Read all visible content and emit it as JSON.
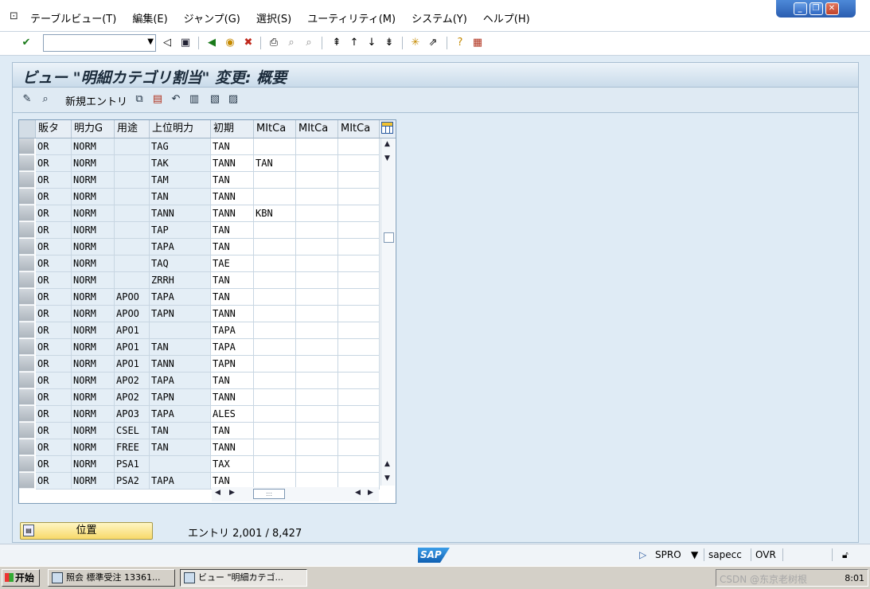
{
  "menu": {
    "items": [
      "テーブルビュー(T)",
      "編集(E)",
      "ジャンプ(G)",
      "選択(S)",
      "ユーティリティ(M)",
      "システム(Y)",
      "ヘルプ(H)"
    ]
  },
  "window_controls": {
    "minimize": "_",
    "restore": "❐",
    "close": "✕"
  },
  "toolbar": {
    "command_field": ""
  },
  "title": "ビュー \"明細カテゴリ割当\" 変更: 概要",
  "app_toolbar": {
    "new_entries": "新規エントリ"
  },
  "table": {
    "columns": [
      "販タ",
      "明力G",
      "用途",
      "上位明力",
      "初期",
      "MItCa",
      "MItCa",
      "MItCa"
    ],
    "rows": [
      [
        "OR",
        "NORM",
        "",
        "TAG",
        "TAN",
        "",
        "",
        ""
      ],
      [
        "OR",
        "NORM",
        "",
        "TAK",
        "TANN",
        "TAN",
        "",
        ""
      ],
      [
        "OR",
        "NORM",
        "",
        "TAM",
        "TAN",
        "",
        "",
        ""
      ],
      [
        "OR",
        "NORM",
        "",
        "TAN",
        "TANN",
        "",
        "",
        ""
      ],
      [
        "OR",
        "NORM",
        "",
        "TANN",
        "TANN",
        "KBN",
        "",
        ""
      ],
      [
        "OR",
        "NORM",
        "",
        "TAP",
        "TAN",
        "",
        "",
        ""
      ],
      [
        "OR",
        "NORM",
        "",
        "TAPA",
        "TAN",
        "",
        "",
        ""
      ],
      [
        "OR",
        "NORM",
        "",
        "TAQ",
        "TAE",
        "",
        "",
        ""
      ],
      [
        "OR",
        "NORM",
        "",
        "ZRRH",
        "TAN",
        "",
        "",
        ""
      ],
      [
        "OR",
        "NORM",
        "APOO",
        "TAPA",
        "TAN",
        "",
        "",
        ""
      ],
      [
        "OR",
        "NORM",
        "APOO",
        "TAPN",
        "TANN",
        "",
        "",
        ""
      ],
      [
        "OR",
        "NORM",
        "APO1",
        "",
        "TAPA",
        "",
        "",
        ""
      ],
      [
        "OR",
        "NORM",
        "APO1",
        "TAN",
        "TAPA",
        "",
        "",
        ""
      ],
      [
        "OR",
        "NORM",
        "APO1",
        "TANN",
        "TAPN",
        "",
        "",
        ""
      ],
      [
        "OR",
        "NORM",
        "APO2",
        "TAPA",
        "TAN",
        "",
        "",
        ""
      ],
      [
        "OR",
        "NORM",
        "APO2",
        "TAPN",
        "TANN",
        "",
        "",
        ""
      ],
      [
        "OR",
        "NORM",
        "APO3",
        "TAPA",
        "ALES",
        "",
        "",
        ""
      ],
      [
        "OR",
        "NORM",
        "CSEL",
        "TAN",
        "TAN",
        "",
        "",
        ""
      ],
      [
        "OR",
        "NORM",
        "FREE",
        "TAN",
        "TANN",
        "",
        "",
        ""
      ],
      [
        "OR",
        "NORM",
        "PSA1",
        "",
        "TAX",
        "",
        "",
        ""
      ],
      [
        "OR",
        "NORM",
        "PSA2",
        "TAPA",
        "TAN",
        "",
        "",
        ""
      ]
    ]
  },
  "position_button": "位置",
  "entries": "エントリ 2,001 / 8,427",
  "status": {
    "logo": "SAP",
    "transaction": "SPRO",
    "server": "sapecc",
    "mode": "OVR"
  },
  "taskbar": {
    "start": "开始",
    "tasks": [
      "照会 標準受注 13361...",
      "ビュー \"明細カテゴ..."
    ],
    "watermark": "CSDN @东京老树根",
    "clock": "8:01"
  }
}
